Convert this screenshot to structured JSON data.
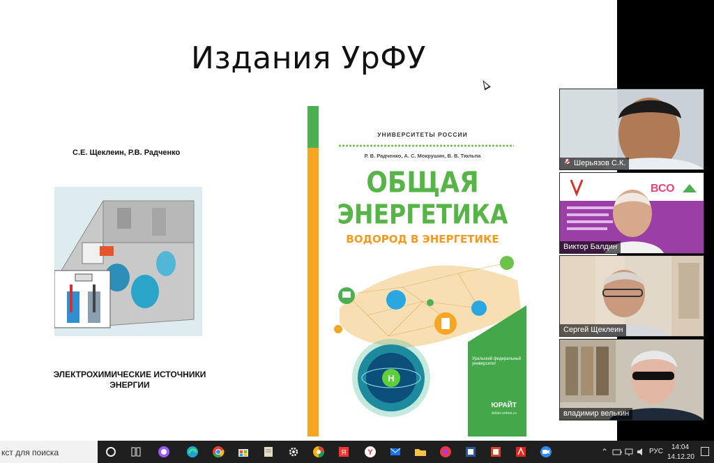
{
  "slide": {
    "title": "Издания УрФУ",
    "book1": {
      "authors": "С.Е. Щеклеин, Р.В. Радченко",
      "title_line1": "ЭЛЕКТРОХИМИЧЕСКИЕ ИСТОЧНИКИ",
      "title_line2": "ЭНЕРГИИ"
    },
    "book2": {
      "series": "УНИВЕРСИТЕТЫ РОССИИ",
      "authors": "Р. В. Радченко, А. С. Мокрушин, В. В. Тюльпа",
      "title_line1": "ОБЩАЯ",
      "title_line2": "ЭНЕРГЕТИКА",
      "subtitle": "ВОДОРОД В ЭНЕРГЕТИКЕ",
      "university": "Уральский федеральный университет",
      "publisher": "ЮРАЙТ",
      "site": "biblio-online.ru",
      "atom_label": "H"
    }
  },
  "participants": [
    {
      "name": "Шерьязов С.К.",
      "muted": true
    },
    {
      "name": "Виктор Балдин",
      "muted": false
    },
    {
      "name": "Сергей Щеклеин",
      "muted": false
    },
    {
      "name": "владимир велькин",
      "muted": false
    }
  ],
  "tile2_banner": {
    "logo_text": "ВСО"
  },
  "taskbar": {
    "search_placeholder": "кст для поиска",
    "language": "РУС",
    "time": "14:04",
    "date": "14.12.20"
  },
  "colors": {
    "cover_green": "#57b447",
    "cover_orange": "#f39a1e",
    "taskbar_bg": "#1f1f1f"
  },
  "icons": [
    "task-view-icon",
    "cortana-icon",
    "edge-icon",
    "chrome-icon",
    "store-icon",
    "notepad-icon",
    "settings-icon",
    "picasa-icon",
    "yandex-icon",
    "yandex-browser-icon",
    "mail-icon",
    "explorer-icon",
    "vivaldi-icon",
    "word-icon",
    "powerpoint-icon",
    "acrobat-icon",
    "zoom-icon"
  ]
}
